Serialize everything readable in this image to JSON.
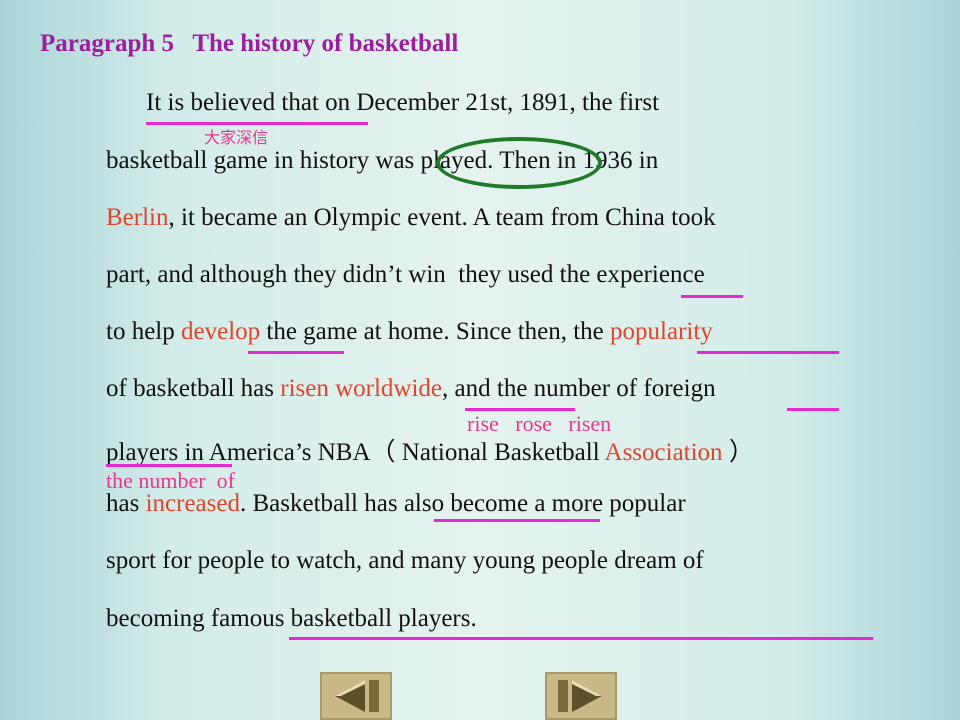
{
  "title": "Paragraph 5   The history of basketball",
  "lines": [
    [
      {
        "t": "It is believed that on December 21st, 1891, the first"
      }
    ],
    [
      {
        "t": "basketball game in history was played. Then in 1936 in"
      }
    ],
    [
      {
        "t": "Berlin",
        "r": true
      },
      {
        "t": ", it became an Olympic event. A team from China took"
      }
    ],
    [
      {
        "t": "part, and although they didn’t win  they used the experience"
      }
    ],
    [
      {
        "t": "to help "
      },
      {
        "t": "develop",
        "r": true
      },
      {
        "t": " the game at home. Since then, the "
      },
      {
        "t": "popularity",
        "r": true
      }
    ],
    [
      {
        "t": "of basketball has "
      },
      {
        "t": "risen worldwide",
        "r": true
      },
      {
        "t": ", and the number of foreign"
      }
    ],
    [
      {
        "t": "players in America’s NBA（ National Basketball "
      },
      {
        "t": "Association",
        "r": true
      },
      {
        "t": " ）"
      }
    ],
    [
      {
        "t": "has "
      },
      {
        "t": "increased",
        "r": true
      },
      {
        "t": ". Basketball has also become a more popular"
      }
    ],
    [
      {
        "t": "sport for people to watch, and many young people dream of"
      }
    ],
    [
      {
        "t": "becoming famous basketball players."
      }
    ]
  ],
  "annotations": {
    "believe_note": "大家深信",
    "verb_forms": "rise   rose   risen",
    "number_note": "the number  of"
  },
  "nav": {
    "prev_icon": "triangle-left-icon",
    "next_icon": "triangle-right-icon"
  },
  "colors": {
    "title": "#9c1e9c",
    "highlight": "#e0442c",
    "annotation": "#e8378e",
    "underline": "#e62ad2",
    "circle": "#1f7a2a",
    "nav_button": "#c9b988"
  }
}
